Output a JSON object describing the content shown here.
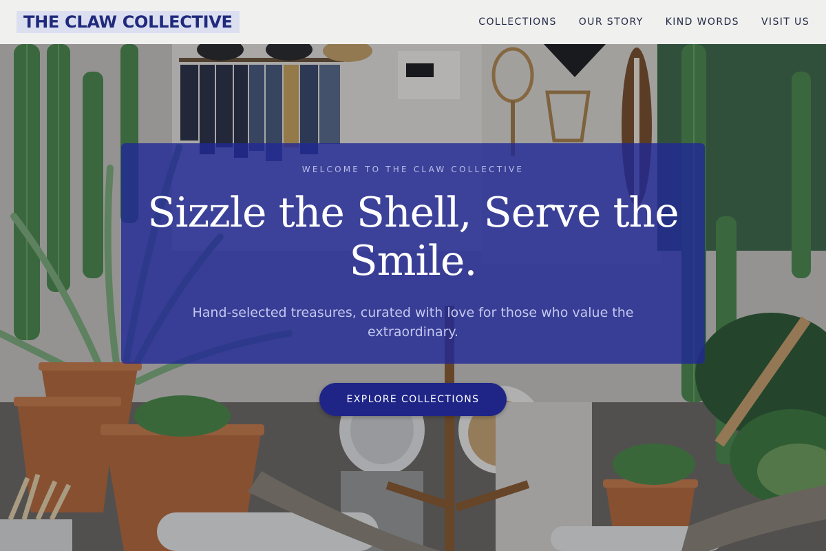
{
  "header": {
    "logo_text": "THE CLAW COLLECTIVE",
    "nav": [
      {
        "label": "COLLECTIONS"
      },
      {
        "label": "OUR STORY"
      },
      {
        "label": "KIND WORDS"
      },
      {
        "label": "VISIT US"
      }
    ]
  },
  "hero": {
    "eyebrow": "WELCOME TO THE CLAW COLLECTIVE",
    "headline": "Sizzle the Shell, Serve the Smile.",
    "subhead": "Hand-selected treasures, curated with love for those who value the extraordinary.",
    "background_image": "boutique-interior-with-cacti-and-plants-photo",
    "cta_label": "EXPLORE COLLECTIONS"
  },
  "colors": {
    "brand_navy": "#1f2a7c",
    "logo_bg": "#dcdff0",
    "header_bg": "#f0f0ef",
    "card_bg": "#2028966",
    "cta_bg": "#1f2587"
  }
}
